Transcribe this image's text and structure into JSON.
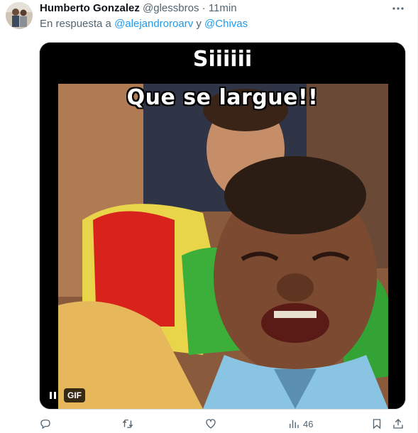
{
  "tweet": {
    "author_name": "Humberto Gonzalez",
    "author_handle": "@glessbros",
    "separator": "·",
    "time": "11min",
    "reply_prefix": "En respuesta a",
    "reply_mention_1": "@alejandroroarv",
    "reply_conjunction": "y",
    "reply_mention_2": "@Chivas"
  },
  "media": {
    "caption_top": "Siiiiii",
    "caption_bottom": "Que se largue!!",
    "badge": "GIF"
  },
  "actions": {
    "views_count": "46"
  },
  "icons": {
    "more": "more-dots-icon",
    "reply": "reply-icon",
    "retweet": "retweet-icon",
    "like": "heart-icon",
    "views": "views-chart-icon",
    "bookmark": "bookmark-icon",
    "share": "share-icon",
    "pause": "pause-icon"
  },
  "colors": {
    "link": "#1d9bf0",
    "secondary_text": "#536471",
    "primary_text": "#0f1419"
  }
}
